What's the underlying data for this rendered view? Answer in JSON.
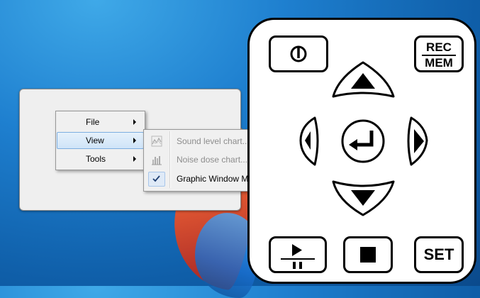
{
  "main_menu": {
    "items": [
      {
        "label": "File"
      },
      {
        "label": "View"
      },
      {
        "label": "Tools"
      }
    ]
  },
  "view_submenu": {
    "items": [
      {
        "label": "Sound level chart...",
        "icon": "sound-level-chart-icon"
      },
      {
        "label": "Noise dose chart...",
        "icon": "noise-dose-chart-icon"
      },
      {
        "label": "Graphic Window Mode",
        "icon": "checkmark-icon"
      }
    ]
  },
  "remote": {
    "rec_top": "REC",
    "rec_bottom": "MEM",
    "set_label": "SET",
    "icons": [
      "power-icon",
      "up-arrow-icon",
      "down-arrow-icon",
      "left-arrow-icon",
      "right-arrow-icon",
      "enter-icon",
      "play-pause-icon",
      "stop-icon"
    ]
  },
  "colors": {
    "desktop_blue": "#1e7fcf",
    "menu_bg": "#f0f0f0",
    "highlight": "#cfe4f8",
    "disabled_text": "#8d8d8d"
  }
}
